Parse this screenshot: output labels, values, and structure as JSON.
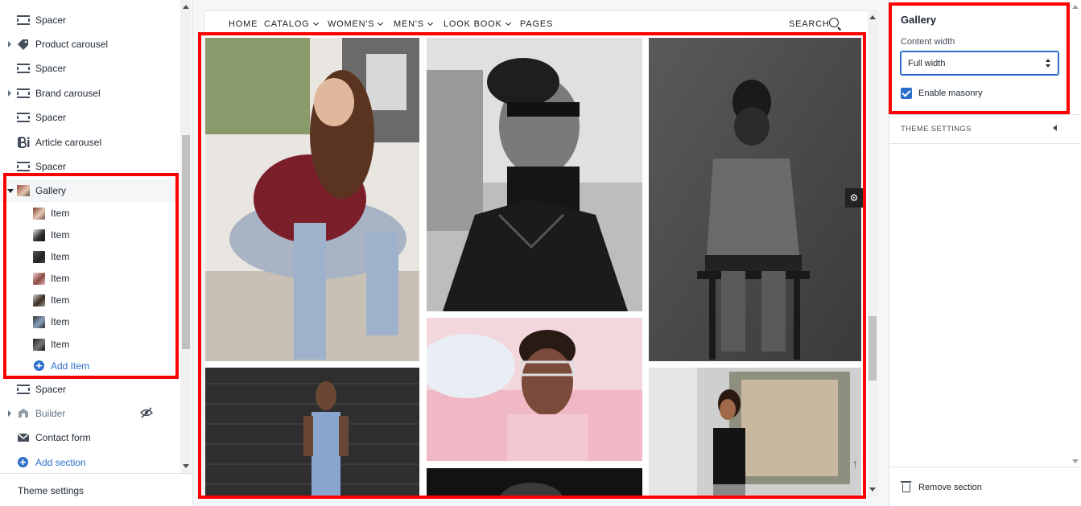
{
  "sidebar": {
    "items": [
      {
        "label": "Spacer",
        "icon": "spacer-icon",
        "caret": "none"
      },
      {
        "label": "Product carousel",
        "icon": "tag-icon",
        "caret": "right"
      },
      {
        "label": "Spacer",
        "icon": "spacer-icon",
        "caret": "none"
      },
      {
        "label": "Brand carousel",
        "icon": "spacer-icon",
        "caret": "right"
      },
      {
        "label": "Spacer",
        "icon": "spacer-icon",
        "caret": "none"
      },
      {
        "label": "Article carousel",
        "icon": "blog-icon",
        "caret": "none"
      },
      {
        "label": "Spacer",
        "icon": "spacer-icon",
        "caret": "none"
      },
      {
        "label": "Gallery",
        "icon": "image-thumbnail",
        "caret": "down"
      }
    ],
    "gallery_children": [
      {
        "label": "Item"
      },
      {
        "label": "Item"
      },
      {
        "label": "Item"
      },
      {
        "label": "Item"
      },
      {
        "label": "Item"
      },
      {
        "label": "Item"
      },
      {
        "label": "Item"
      }
    ],
    "add_item": "Add Item",
    "after": [
      {
        "label": "Spacer",
        "icon": "spacer-icon"
      },
      {
        "label": "Builder",
        "icon": "builder-icon",
        "hidden": true
      },
      {
        "label": "Contact form",
        "icon": "envelope-icon"
      }
    ],
    "add_section": "Add section",
    "theme_settings": "Theme settings"
  },
  "preview": {
    "nav": [
      "HOME",
      "CATALOG",
      "WOMEN'S",
      "MEN'S",
      "LOOK BOOK",
      "PAGES"
    ],
    "nav_dropdowns": [
      false,
      true,
      true,
      true,
      true,
      true
    ],
    "search": "SEARCH"
  },
  "panel": {
    "title": "Gallery",
    "content_width_label": "Content width",
    "content_width_value": "Full width",
    "enable_masonry_label": "Enable masonry",
    "enable_masonry": true,
    "theme_settings": "THEME SETTINGS",
    "remove_section": "Remove section"
  },
  "colors": {
    "highlight": "#ff0000",
    "accent": "#2c6ecb"
  }
}
